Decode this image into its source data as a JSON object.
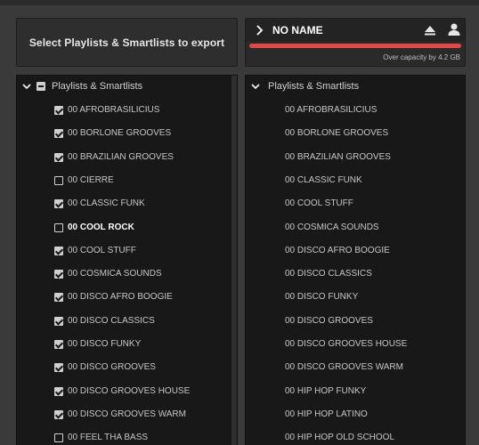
{
  "export_button": {
    "label": "Select Playlists & Smartlists to export"
  },
  "device": {
    "name": "NO NAME",
    "capacity_text": "Over capacity by 4.2 GB",
    "capacity_color": "#e04848"
  },
  "left_panel": {
    "header": "Playlists & Smartlists",
    "items": [
      {
        "label": "00 AFROBRASILICIUS",
        "checked": true
      },
      {
        "label": "00 BORLONE GROOVES",
        "checked": true
      },
      {
        "label": "00 BRAZILIAN GROOVES",
        "checked": true
      },
      {
        "label": "00 CIERRE",
        "checked": false
      },
      {
        "label": "00 CLASSIC FUNK",
        "checked": true
      },
      {
        "label": "00 COOL ROCK",
        "checked": false,
        "highlight": true
      },
      {
        "label": "00 COOL STUFF",
        "checked": true
      },
      {
        "label": "00 COSMICA SOUNDS",
        "checked": true
      },
      {
        "label": "00 DISCO AFRO BOOGIE",
        "checked": true
      },
      {
        "label": "00 DISCO CLASSICS",
        "checked": true
      },
      {
        "label": "00 DISCO FUNKY",
        "checked": true
      },
      {
        "label": "00 DISCO GROOVES",
        "checked": true
      },
      {
        "label": "00 DISCO GROOVES HOUSE",
        "checked": true
      },
      {
        "label": "00 DISCO GROOVES WARM",
        "checked": true
      },
      {
        "label": "00 FEEL THA BASS",
        "checked": false
      }
    ]
  },
  "right_panel": {
    "header": "Playlists & Smartlists",
    "items": [
      "00 AFROBRASILICIUS",
      "00 BORLONE GROOVES",
      "00 BRAZILIAN GROOVES",
      "00 CLASSIC FUNK",
      "00 COOL STUFF",
      "00 COSMICA SOUNDS",
      "00 DISCO AFRO BOOGIE",
      "00 DISCO CLASSICS",
      "00 DISCO FUNKY",
      "00 DISCO GROOVES",
      "00 DISCO GROOVES HOUSE",
      "00 DISCO GROOVES WARM",
      "00 HIP HOP FUNKY",
      "00 HIP HOP LATINO",
      "00 HIP HOP OLD SCHOOL"
    ]
  }
}
